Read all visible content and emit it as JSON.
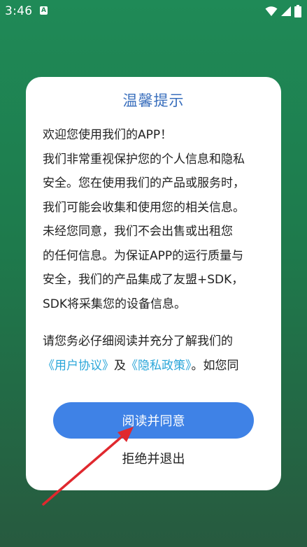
{
  "status_bar": {
    "time": "3:46",
    "a_icon": "A",
    "icons": [
      "a-notification-icon",
      "wifi-icon",
      "signal-icon",
      "battery-icon"
    ]
  },
  "dialog": {
    "title": "温馨提示",
    "lines": [
      "欢迎您使用我们的APP！",
      "我们非常重视保护您的个人信息和隐私",
      "安全。您在使用我们的产品或服务时，",
      "我们可能会收集和使用您的相关信息。",
      "未经您同意，我们不会出售或出租您",
      "的任何信息。为保证APP的运行质量与",
      "安全，我们的产品集成了友盟+SDK，",
      "SDK将采集您的设备信息。"
    ],
    "para2_line1": "请您务必仔细阅读并充分了解我们的",
    "user_agreement_link": "《用户协议》",
    "and_text": "及",
    "privacy_policy_link": "《隐私政策》",
    "after_links_text": "。如您同",
    "agree_label": "阅读并同意",
    "reject_label": "拒绝并退出"
  },
  "colors": {
    "accent": "#3f82e6",
    "title": "#3a6fbd",
    "link": "#2aa6d9",
    "background_top": "#1f8a57",
    "annotation_arrow": "#e0282e"
  }
}
